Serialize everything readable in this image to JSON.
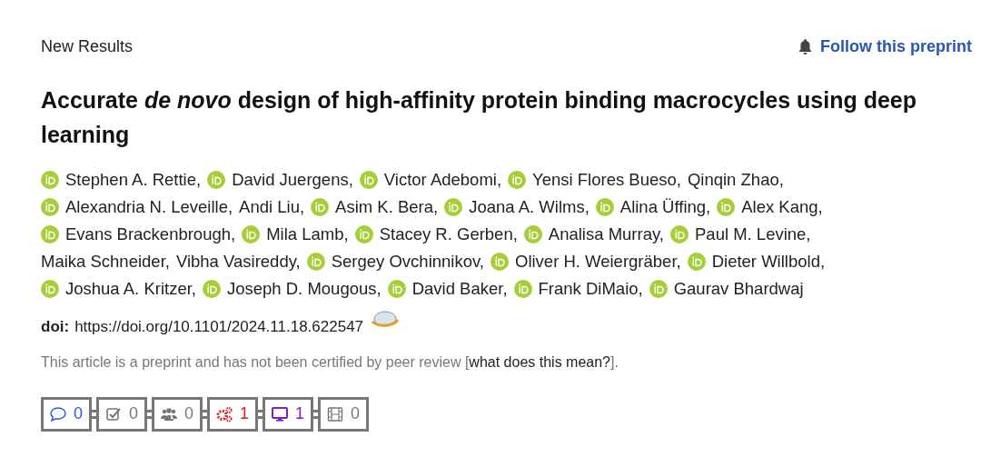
{
  "section_label": "New Results",
  "follow_link": "Follow this preprint",
  "title": "Accurate *de novo* design of high-affinity protein binding macrocycles using deep learning",
  "authors": [
    {
      "name": "Stephen A. Rettie,",
      "orcid": true
    },
    {
      "name": "David Juergens,",
      "orcid": true
    },
    {
      "name": "Victor Adebomi,",
      "orcid": true
    },
    {
      "name": "Yensi Flores Bueso,",
      "orcid": true
    },
    {
      "name": "Qinqin Zhao,",
      "orcid": false
    },
    {
      "name": "Alexandria N. Leveille,",
      "orcid": true
    },
    {
      "name": "Andi Liu,",
      "orcid": false
    },
    {
      "name": "Asim K. Bera,",
      "orcid": true
    },
    {
      "name": "Joana A. Wilms,",
      "orcid": true
    },
    {
      "name": "Alina Üffing,",
      "orcid": true
    },
    {
      "name": "Alex Kang,",
      "orcid": true
    },
    {
      "name": "Evans Brackenbrough,",
      "orcid": true
    },
    {
      "name": "Mila Lamb,",
      "orcid": true
    },
    {
      "name": "Stacey R. Gerben,",
      "orcid": true
    },
    {
      "name": "Analisa Murray,",
      "orcid": true
    },
    {
      "name": "Paul M. Levine,",
      "orcid": true
    },
    {
      "name": "Maika Schneider,",
      "orcid": false
    },
    {
      "name": "Vibha Vasireddy,",
      "orcid": false
    },
    {
      "name": "Sergey Ovchinnikov,",
      "orcid": true
    },
    {
      "name": "Oliver H. Weiergräber,",
      "orcid": true
    },
    {
      "name": "Dieter Willbold,",
      "orcid": true
    },
    {
      "name": "Joshua A. Kritzer,",
      "orcid": true
    },
    {
      "name": "Joseph D. Mougous,",
      "orcid": true
    },
    {
      "name": "David Baker,",
      "orcid": true
    },
    {
      "name": "Frank DiMaio,",
      "orcid": true
    },
    {
      "name": "Gaurav Bhardwaj",
      "orcid": true
    }
  ],
  "doi": {
    "label": "doi:",
    "url": "https://doi.org/10.1101/2024.11.18.622547"
  },
  "notice": {
    "text": "This article is a preprint and has not been certified by peer review [",
    "link": "what does this mean?",
    "end": "]."
  },
  "metrics": [
    {
      "kind": "comments",
      "count": "0",
      "color": "#2a5bd7"
    },
    {
      "kind": "reviews",
      "count": "0",
      "color": "#777777"
    },
    {
      "kind": "community",
      "count": "0",
      "color": "#777777"
    },
    {
      "kind": "tools",
      "count": "1",
      "color": "#d42020"
    },
    {
      "kind": "screen",
      "count": "1",
      "color": "#7a1fd0"
    },
    {
      "kind": "video",
      "count": "0",
      "color": "#777777"
    }
  ]
}
